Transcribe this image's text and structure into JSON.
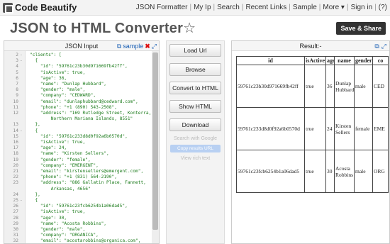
{
  "brand": {
    "name": "Code Beautify"
  },
  "topnav": [
    "JSON Formatter",
    "My Ip",
    "Search",
    "Recent Links",
    "Sample",
    "More ▾",
    "Sign in",
    "(?)"
  ],
  "page": {
    "title": "JSON to HTML Converter",
    "star": "☆",
    "save_share": "Save & Share"
  },
  "left_panel": {
    "title": "JSON Input",
    "sample_label": "sample"
  },
  "editor": {
    "lines": [
      {
        "n": "2",
        "f": "-",
        "t": "\"clients\": ["
      },
      {
        "n": "3",
        "f": "-",
        "t": "  {"
      },
      {
        "n": "4",
        "f": "",
        "t": "    \"id\": \"59761c23b30d971669fb42ff\","
      },
      {
        "n": "5",
        "f": "",
        "t": "    \"isActive\": true,"
      },
      {
        "n": "6",
        "f": "",
        "t": "    \"age\": 36,"
      },
      {
        "n": "7",
        "f": "",
        "t": "    \"name\": \"Dunlap Hubbard\","
      },
      {
        "n": "8",
        "f": "",
        "t": "    \"gender\": \"male\","
      },
      {
        "n": "9",
        "f": "",
        "t": "    \"company\": \"CEDWARD\","
      },
      {
        "n": "10",
        "f": "",
        "t": "    \"email\": \"dunlaphubbard@cedward.com\","
      },
      {
        "n": "11",
        "f": "",
        "t": "    \"phone\": \"+1 (890) 543-2508\","
      },
      {
        "n": "12",
        "f": "",
        "t": "    \"address\": \"169 Rutledge Street, Konterra,"
      },
      {
        "n": "",
        "f": "",
        "t": "        Northern Mariana Islands, 8551\""
      },
      {
        "n": "13",
        "f": "",
        "t": "  },"
      },
      {
        "n": "14",
        "f": "-",
        "t": "  {"
      },
      {
        "n": "15",
        "f": "",
        "t": "    \"id\": \"59761c233d8d0f92a6b0570d\","
      },
      {
        "n": "16",
        "f": "",
        "t": "    \"isActive\": true,"
      },
      {
        "n": "17",
        "f": "",
        "t": "    \"age\": 24,"
      },
      {
        "n": "18",
        "f": "",
        "t": "    \"name\": \"Kirsten Sellers\","
      },
      {
        "n": "19",
        "f": "",
        "t": "    \"gender\": \"female\","
      },
      {
        "n": "20",
        "f": "",
        "t": "    \"company\": \"EMERGENT\","
      },
      {
        "n": "21",
        "f": "",
        "t": "    \"email\": \"kirstensellers@emergent.com\","
      },
      {
        "n": "22",
        "f": "",
        "t": "    \"phone\": \"+1 (831) 564-2190\","
      },
      {
        "n": "23",
        "f": "",
        "t": "    \"address\": \"886 Gallatin Place, Fannett,"
      },
      {
        "n": "",
        "f": "",
        "t": "        Arkansas, 4656\""
      },
      {
        "n": "24",
        "f": "",
        "t": "  },"
      },
      {
        "n": "25",
        "f": "-",
        "t": "  {"
      },
      {
        "n": "26",
        "f": "",
        "t": "    \"id\": \"59761c23fcb6254b1a06dad5\","
      },
      {
        "n": "27",
        "f": "",
        "t": "    \"isActive\": true,"
      },
      {
        "n": "28",
        "f": "",
        "t": "    \"age\": 30,"
      },
      {
        "n": "29",
        "f": "",
        "t": "    \"name\": \"Acosta Robbins\","
      },
      {
        "n": "30",
        "f": "",
        "t": "    \"gender\": \"male\","
      },
      {
        "n": "31",
        "f": "",
        "t": "    \"company\": \"ORGANICA\","
      },
      {
        "n": "32",
        "f": "",
        "t": "    \"email\": \"acostarobbins@organica.com\","
      },
      {
        "n": "33",
        "f": "",
        "t": "    \"phone\": \"+1 (882) 441-3367\","
      }
    ]
  },
  "middle": {
    "buttons": [
      "Load Url",
      "Browse",
      "Convert to HTML",
      "Show HTML",
      "Download"
    ],
    "blurred": [
      "Search with Google",
      "Copy results URL",
      "View rich text"
    ]
  },
  "right_panel": {
    "title": "Result:-"
  },
  "table": {
    "headers": [
      "id",
      "isActive",
      "age",
      "name",
      "gender",
      "co"
    ],
    "rows": [
      [
        "59761c23b30d971669fb42ff",
        "true",
        "36",
        "Dunlap Hubbard",
        "male",
        "CED"
      ],
      [
        "59761c233d8d0f92a6b0570d",
        "true",
        "24",
        "Kirsten Sellers",
        "female",
        "EME"
      ],
      [
        "59761c23fcb6254b1a06dad5",
        "true",
        "30",
        "Acosta Robbins",
        "male",
        "ORG"
      ]
    ]
  },
  "colors": {
    "accent": "#1a5fb4",
    "dark_button": "#333333",
    "code_text": "#1a7a1a"
  }
}
